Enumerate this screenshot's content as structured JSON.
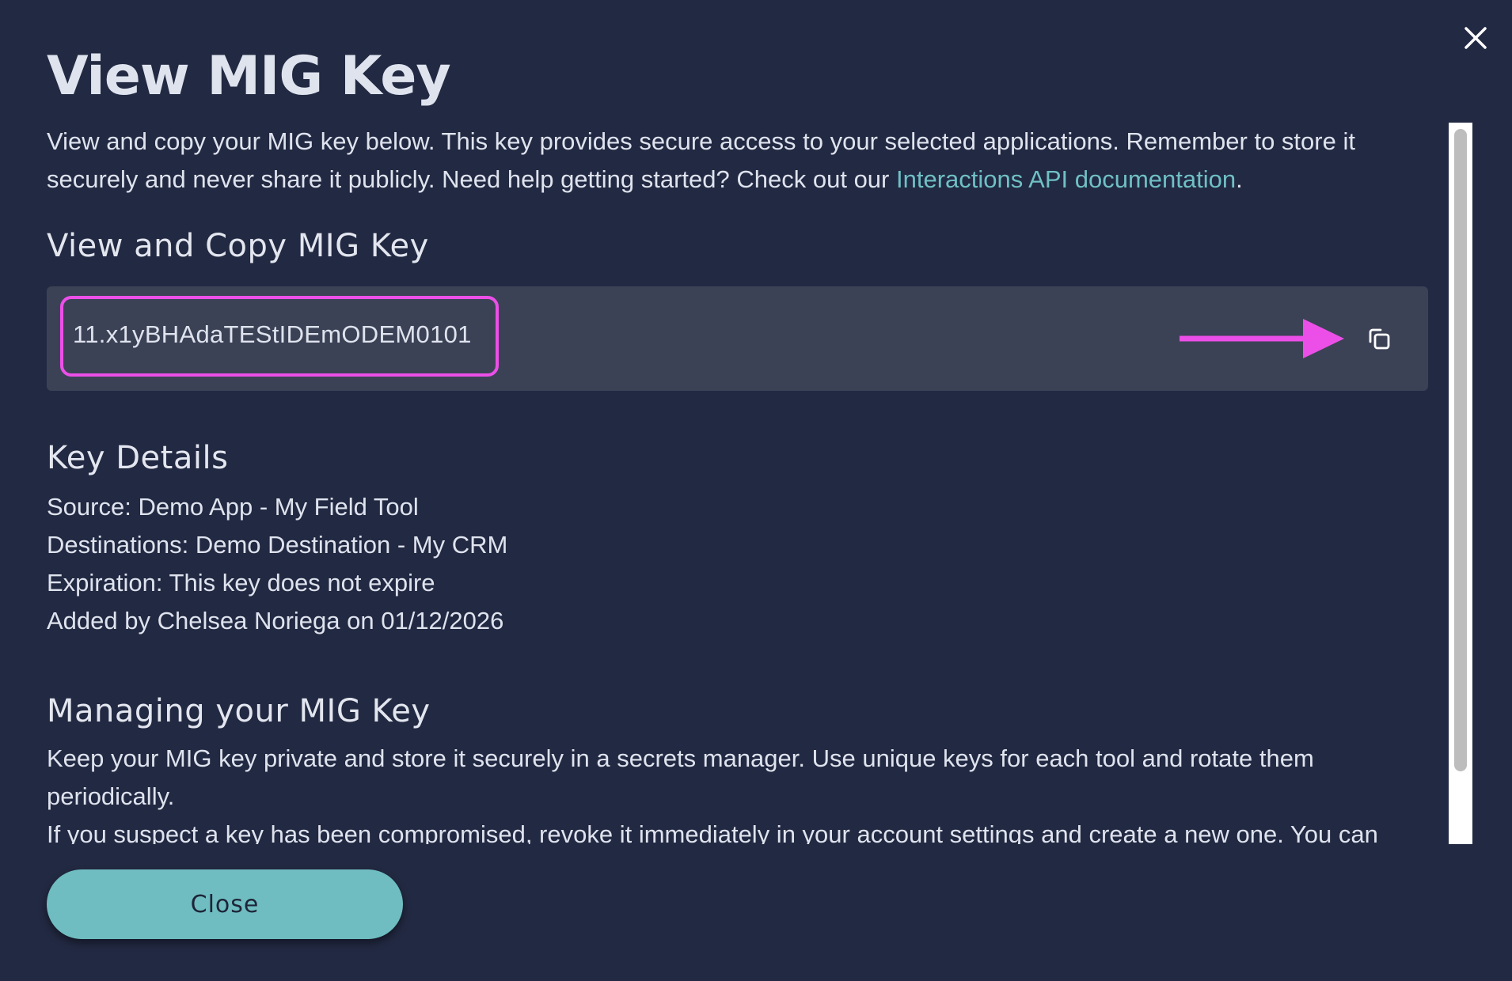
{
  "modal": {
    "title": "View MIG Key",
    "intro_text": "View and copy your MIG key below. This key provides secure access to your selected applications. Remember to store it securely and never share it publicly. Need help getting started? Check out our ",
    "intro_link": "Interactions API documentation",
    "intro_end": ".",
    "close_icon": "close-icon"
  },
  "key_section": {
    "heading": "View and Copy MIG Key",
    "key_value": "11.x1yBHAdaTEStIDEmODEM0101",
    "copy_icon": "copy-icon",
    "highlight_color": "#ec4fe8"
  },
  "details": {
    "heading": "Key Details",
    "source": "Source: Demo App - My Field Tool",
    "destinations": "Destinations: Demo Destination - My CRM",
    "expiration": "Expiration: This key does not expire",
    "added_by": "Added by Chelsea Noriega on 01/12/2026"
  },
  "managing": {
    "heading": "Managing your MIG Key",
    "paragraph_1": "Keep your MIG key private and store it securely in a secrets manager. Use unique keys for each tool and rotate them periodically.",
    "paragraph_2": "If you suspect a key has been compromised, revoke it immediately in your account settings and create a new one. You can"
  },
  "footer": {
    "close_label": "Close"
  },
  "colors": {
    "background": "#222942",
    "accent": "#6fbdc0",
    "link": "#6fc0c4",
    "key_box": "#3c4256"
  }
}
